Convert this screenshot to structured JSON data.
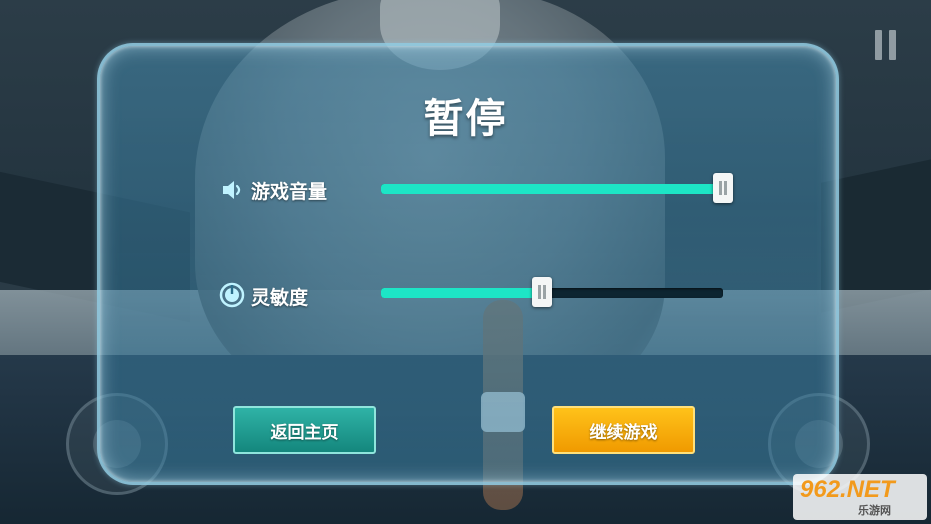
{
  "title": "暂停",
  "settings": [
    {
      "label": "游戏音量",
      "icon": "speaker-icon",
      "value": 1.0
    },
    {
      "label": "灵敏度",
      "icon": "gauge-icon",
      "value": 0.47
    }
  ],
  "buttons": {
    "home_label": "返回主页",
    "continue_label": "继续游戏"
  },
  "hud": {
    "pause_icon": "pause-icon"
  },
  "watermark": {
    "main": "962.NET",
    "sub": "乐游网"
  },
  "colors": {
    "slider_fill": "#1de5c6",
    "home_button": "#1f9c91",
    "continue_button": "#ffb20f"
  }
}
